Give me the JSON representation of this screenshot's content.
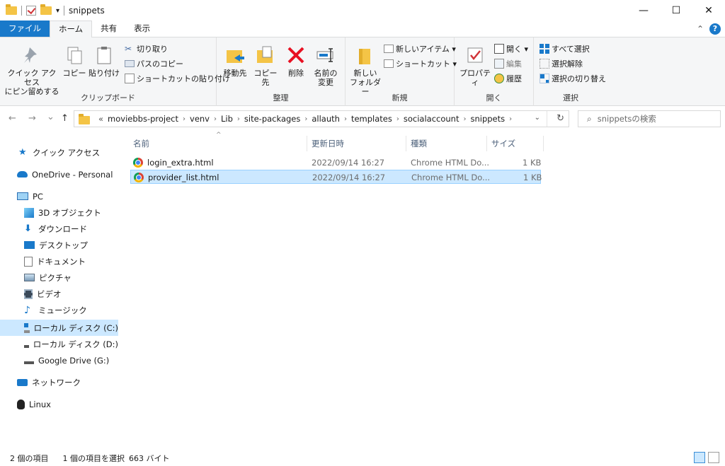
{
  "titlebar": {
    "title": "snippets",
    "qa_dropdown": "▾",
    "minimize": "—",
    "maximize": "☐",
    "close": "✕"
  },
  "tabs": [
    {
      "label": "ファイル"
    },
    {
      "label": "ホーム"
    },
    {
      "label": "共有"
    },
    {
      "label": "表示"
    }
  ],
  "tabs_right": {
    "collapse": "⌃",
    "help": "?"
  },
  "ribbon": {
    "clipboard": {
      "label": "クリップボード",
      "pin": "クイック アクセス\nにピン留めする",
      "copy": "コピー",
      "paste": "貼り付け",
      "cut": "切り取り",
      "copy_path": "パスのコピー",
      "paste_shortcut": "ショートカットの貼り付け"
    },
    "organize": {
      "label": "整理",
      "move_to": "移動先",
      "copy_to": "コピー先",
      "delete": "削除",
      "rename": "名前の\n変更"
    },
    "new": {
      "label": "新規",
      "new_folder": "新しい\nフォルダー",
      "new_item": "新しいアイテム ▾",
      "shortcut": "ショートカット ▾"
    },
    "open": {
      "label": "開く",
      "properties": "プロパティ",
      "open": "開く ▾",
      "edit": "編集",
      "history": "履歴"
    },
    "select": {
      "label": "選択",
      "select_all": "すべて選択",
      "select_none": "選択解除",
      "invert": "選択の切り替え"
    }
  },
  "nav": {
    "back": "←",
    "forward": "→",
    "recent": "⌄",
    "up": "↑",
    "overflow": "«",
    "crumbs": [
      "moviebbs-project",
      "venv",
      "Lib",
      "site-packages",
      "allauth",
      "templates",
      "socialaccount",
      "snippets"
    ],
    "sep": "›",
    "dropdown": "⌄",
    "refresh": "↻",
    "search_placeholder": "snippetsの検索"
  },
  "sidebar": {
    "items": [
      {
        "label": "クイック アクセス"
      },
      {
        "label": "OneDrive - Personal"
      },
      {
        "label": "PC"
      },
      {
        "label": "3D オブジェクト"
      },
      {
        "label": "ダウンロード"
      },
      {
        "label": "デスクトップ"
      },
      {
        "label": "ドキュメント"
      },
      {
        "label": "ピクチャ"
      },
      {
        "label": "ビデオ"
      },
      {
        "label": "ミュージック"
      },
      {
        "label": "ローカル ディスク (C:)"
      },
      {
        "label": "ローカル ディスク (D:)"
      },
      {
        "label": "Google Drive (G:)"
      },
      {
        "label": "ネットワーク"
      },
      {
        "label": "Linux"
      }
    ]
  },
  "filelist": {
    "columns": {
      "name": "名前",
      "date": "更新日時",
      "type": "種類",
      "size": "サイズ",
      "sort": "^"
    },
    "rows": [
      {
        "name": "login_extra.html",
        "date": "2022/09/14 16:27",
        "type": "Chrome HTML Do...",
        "size": "1 KB"
      },
      {
        "name": "provider_list.html",
        "date": "2022/09/14 16:27",
        "type": "Chrome HTML Do...",
        "size": "1 KB"
      }
    ]
  },
  "status": {
    "count": "2 個の項目",
    "selected": "1 個の項目を選択",
    "bytes": "663 バイト"
  }
}
